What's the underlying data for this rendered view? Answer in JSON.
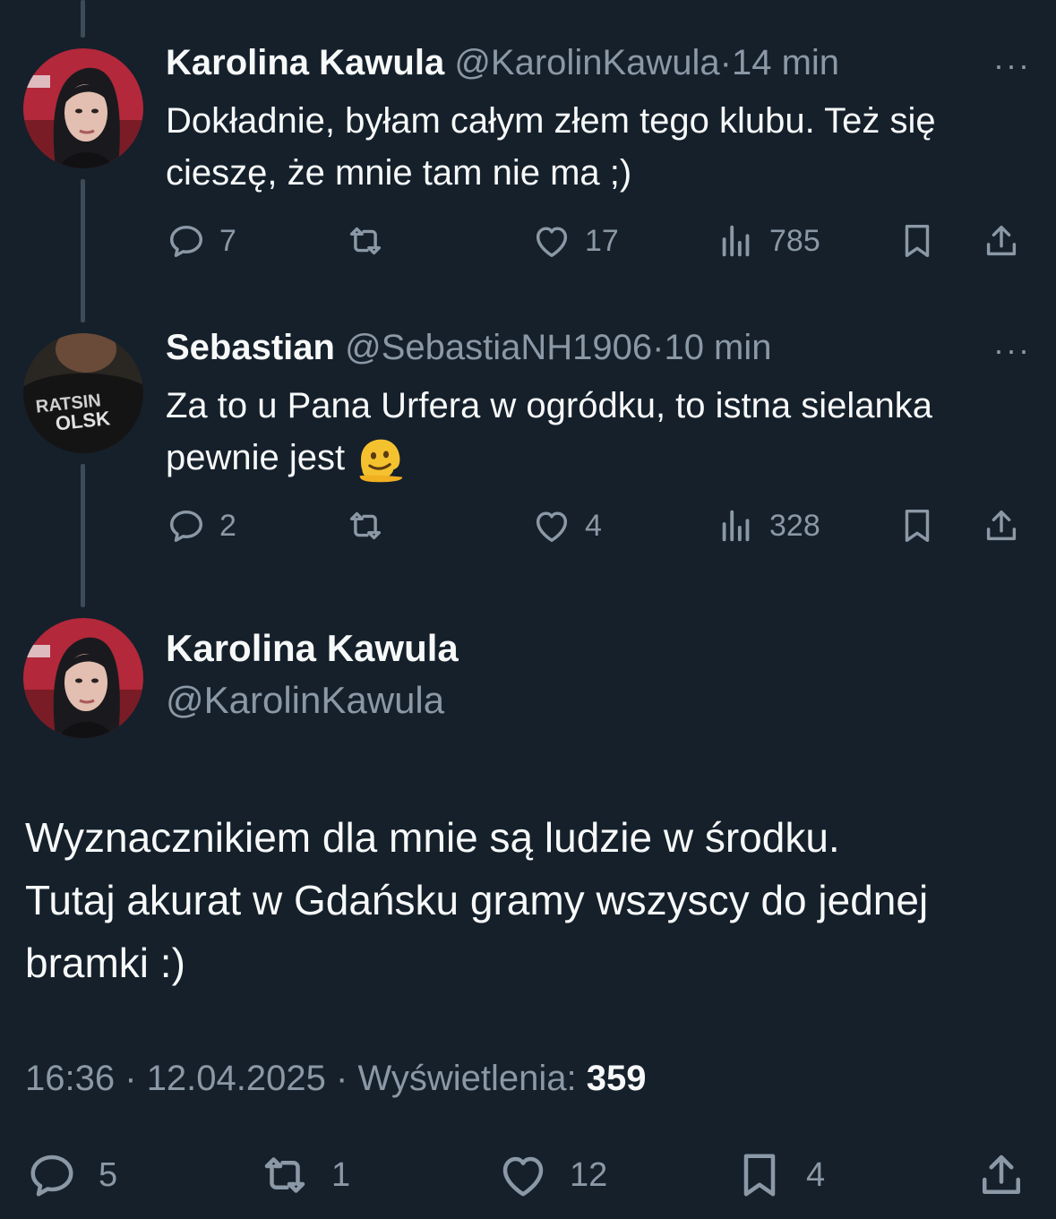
{
  "reply1": {
    "name": "Karolina Kawula",
    "handle": "@KarolinKawula",
    "sep": "·",
    "time": "14 min",
    "more": "···",
    "text": "Dokładnie, byłam całym złem tego klubu. Też się cieszę, że mnie tam nie ma ;)",
    "replies": "7",
    "likes": "17",
    "views": "785"
  },
  "reply2": {
    "name": "Sebastian",
    "handle": "@SebastiaNH1906",
    "sep": "·",
    "time": "10 min",
    "more": "···",
    "text": "Za to u Pana Urfera w ogródku, to istna sielanka pewnie jest",
    "emoji": "melting-face",
    "replies": "2",
    "likes": "4",
    "views": "328"
  },
  "main": {
    "name": "Karolina Kawula",
    "handle": "@KarolinKawula",
    "text_line1": "Wyznacznikiem dla mnie są ludzie w środku.",
    "text_line2": "Tutaj akurat w Gdańsku gramy wszyscy do jednej",
    "text_line3": "bramki :)",
    "time": "16:36",
    "sep": "·",
    "date": "12.04.2025",
    "views_label": "Wyświetlenia:",
    "views": "359",
    "replies": "5",
    "reposts": "1",
    "likes": "12",
    "bookmarks": "4"
  },
  "colors": {
    "background": "#15202b",
    "muted": "#8b98a5",
    "text": "#f7f9f9",
    "thread_line": "#3d4a57"
  }
}
